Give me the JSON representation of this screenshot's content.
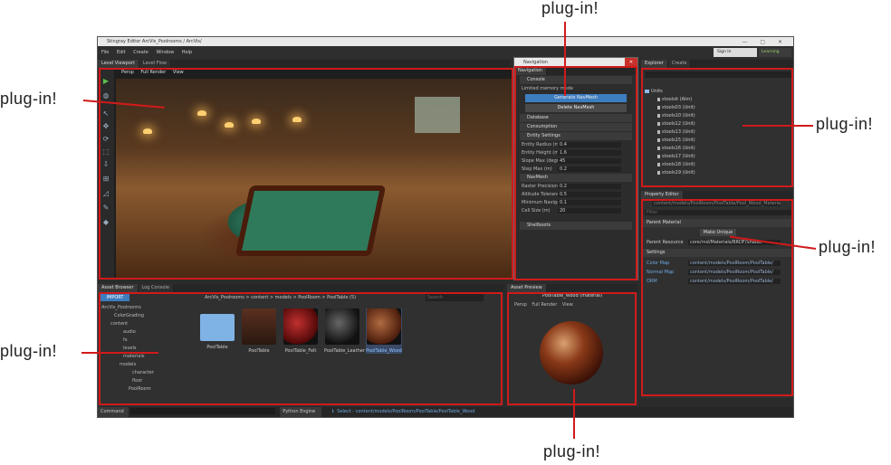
{
  "annotation_label": "plug-in!",
  "window": {
    "title": "Stingray Editor  ArcVis_Poolrooms / ArcVis/"
  },
  "menu": [
    "File",
    "Edit",
    "Create",
    "Window",
    "Help"
  ],
  "account": {
    "sign_in": "Sign In",
    "learning": "Learning"
  },
  "viewport": {
    "tabs": [
      "Level Viewport",
      "Level Flow"
    ],
    "toolbar": [
      "Persp",
      "Full Render",
      "View"
    ]
  },
  "navigation": {
    "window_title": "Navigation",
    "tab": "Navigation",
    "sections": {
      "console": "Console",
      "database": "Database",
      "consumption": "Consumption",
      "entity_settings": "Entity Settings",
      "navmesh": "NavMesh",
      "shell_boots": "Shellboots"
    },
    "limited_memory": "Limited memory mode",
    "buttons": {
      "generate": "Generate NavMesh",
      "delete": "Delete NavMesh"
    },
    "entity_fields": [
      {
        "label": "Entity Radius (m)",
        "value": "0.4"
      },
      {
        "label": "Entity Height (m)",
        "value": "1.6"
      },
      {
        "label": "Slope Max (degrees)",
        "value": "45"
      },
      {
        "label": "Step Max (m)",
        "value": "0.2"
      }
    ],
    "navmesh_fields": [
      {
        "label": "Raster Precision (m)",
        "value": "0.2"
      },
      {
        "label": "Altitude Tolerance (m)",
        "value": "0.5"
      },
      {
        "label": "Minimum Navigable...",
        "value": "0.1"
      },
      {
        "label": "Cell Size (m)",
        "value": "20"
      }
    ]
  },
  "explorer": {
    "tabs": [
      "Explorer",
      "Create"
    ],
    "root": "Units",
    "items": [
      "stoolsit (Alm)",
      "stools03 (Unit)",
      "stools10 (Unit)",
      "stools12 (Unit)",
      "stools13 (Unit)",
      "stools15 (Unit)",
      "stools16 (Unit)",
      "stools17 (Unit)",
      "stools18 (Unit)",
      "stools19 (Unit)"
    ]
  },
  "property_editor": {
    "tab": "Property Editor",
    "path": "content/models/PoolRoom/PoolTable/Pool_Wood_Material",
    "filter_placeholder": "Filter",
    "parent_section": "Parent Material",
    "make_unique": "Make Unique",
    "parent_label": "Parent Resource",
    "parent_value": "core/rnd/Materials/BRDF/Shader",
    "settings_section": "Settings",
    "rows": [
      {
        "label": "Color Map",
        "value": "content/models/PoolRoom/PoolTable/"
      },
      {
        "label": "Normal Map",
        "value": "content/models/PoolRoom/PoolTable/"
      },
      {
        "label": "ORM",
        "value": "content/models/PoolRoom/PoolTable/"
      }
    ]
  },
  "asset_browser": {
    "tabs": [
      "Asset Browser",
      "Log Console"
    ],
    "import": "IMPORT",
    "breadcrumb": "ArcVis_Poolrooms > content > models > PoolRoom > PoolTable (5)",
    "search_placeholder": "Search",
    "tree": [
      "ArcVis_Poolrooms",
      "ColorGrading",
      "content",
      "audio",
      "fx",
      "levels",
      "materials",
      "models",
      "character",
      "floor",
      "PoolRoom"
    ],
    "assets": [
      {
        "name": "PoolTable"
      },
      {
        "name": "PoolTable"
      },
      {
        "name": "PoolTable_Felt"
      },
      {
        "name": "PoolTable_Leather"
      },
      {
        "name": "PoolTable_Wood"
      }
    ]
  },
  "asset_preview": {
    "tab": "Asset Preview",
    "title": "PoolTable_Wood (material)",
    "toolbar": [
      "Persp",
      "Full Render",
      "View"
    ]
  },
  "statusbar": {
    "command": "Command",
    "python_engine": "Python Engine",
    "select_text": "Select - content/models/PoolRoom/PoolTable/PoolTable_Wood"
  }
}
